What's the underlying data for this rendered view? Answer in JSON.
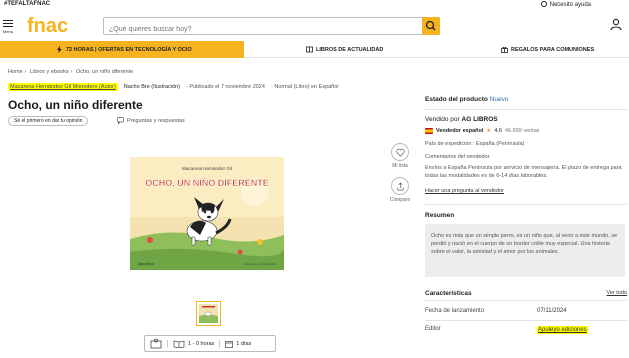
{
  "topbar": {
    "hashtag": "#TEFALTAFNAC",
    "help": "Necesito ayuda"
  },
  "header": {
    "menu_label": "Menú",
    "logo_text": "fnac",
    "search_placeholder": "¿Qué quieres buscar hoy?"
  },
  "promos": [
    {
      "label": "72 HORAS | OFERTAS EN TECNOLOGÍA Y OCIO"
    },
    {
      "label": "LIBROS DE ACTUALIDAD"
    },
    {
      "label": "REGALOS PARA COMUNIONES"
    }
  ],
  "breadcrumb": [
    "Home",
    "Libros y ebooks",
    "Ocho, un niño diferente"
  ],
  "product": {
    "author": "Macarena Hernández Gil Monedero (Autor)",
    "illustrator": "Nacho Bre (Ilustración)",
    "published": "Publicado el 7 noviembre 2024",
    "format": "Normal (Libro) en Español",
    "title": "Ocho, un niño diferente",
    "first_review": "Sé el primero en dar tu opinión",
    "qa": "Preguntas y respuestas",
    "wishlist": "Mi lista",
    "compare": "Comparo",
    "cover_author": "Macarena Hernández Gil",
    "cover_title": "OCHO, UN NIÑO DIFERENTE",
    "cover_publisher": "Apuleyo",
    "cover_illustrator": "Ilustrado por Nacho Bre"
  },
  "extras": {
    "hours": "1 - 0 horas",
    "days": "1 días"
  },
  "right_panel": {
    "estado_label": "Estado del producto",
    "estado_value": "Nuevo",
    "sold_by_label": "Vendido por",
    "seller": "AG LIBROS",
    "seller_type": "Vendedor español",
    "rating": "4.6",
    "sales": "46.699 ventas",
    "shipping": "País de expedición : España (Península)",
    "comments_label": "Comentarios del vendedor",
    "comments_text": "Envíos a España Península por servicio de mensajería. El plazo de entrega para todas las modalidades es de 6-14 días laborables.",
    "ask_seller": "Hacer una pregunta al vendedor",
    "summary_label": "Resumen",
    "summary_text": "Ocho es más que un simple perro, es un niño que, al venir a este mundo, se perdió y nació en el cuerpo de un border collie muy especial. Una historia sobre el valor, la amistad y el amor por los animales.",
    "characteristics_label": "Características",
    "see_all": "Ver todo",
    "release_label": "Fecha de lanzamiento",
    "release_value": "07/11/2024",
    "editor_label": "Editor",
    "editor_value": "Apuleyo ediciones"
  },
  "colors": {
    "brand_yellow": "#f5b320",
    "highlight": "#ffff00",
    "link_blue": "#2e6ba8"
  }
}
